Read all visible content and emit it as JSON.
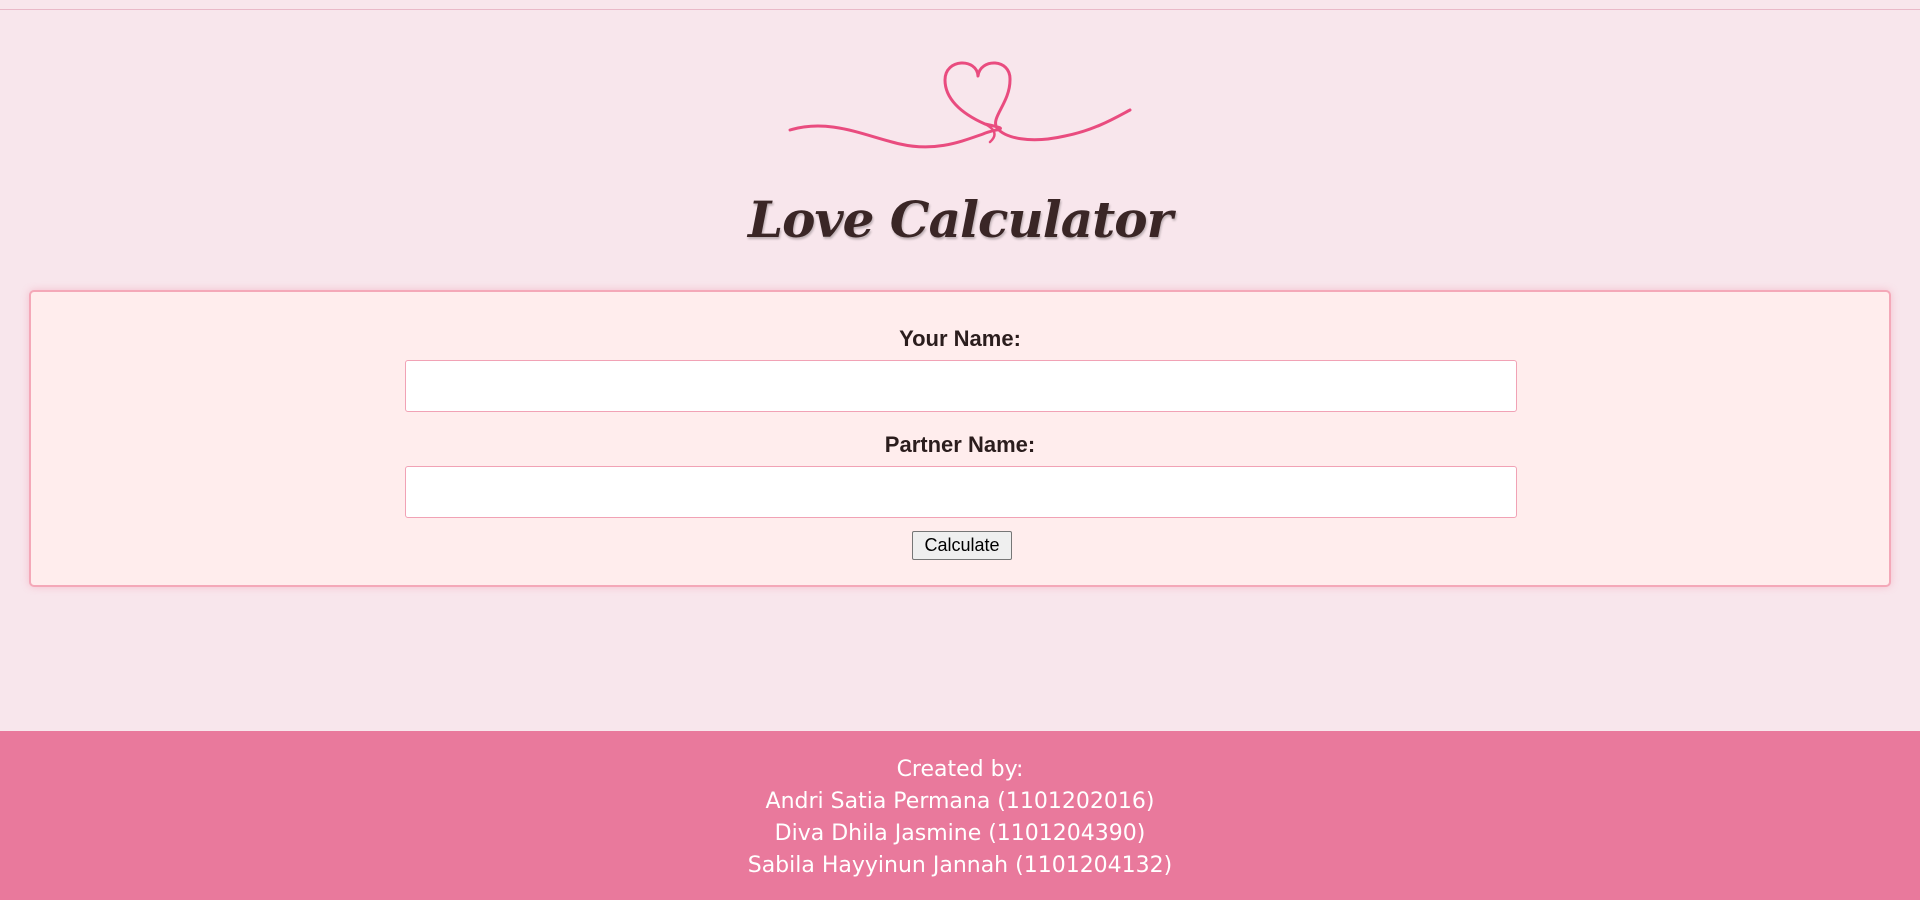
{
  "header": {
    "logo_icon": "heart-ribbon-icon",
    "title": "Love Calculator"
  },
  "form": {
    "your_name_label": "Your Name:",
    "your_name_value": "",
    "partner_name_label": "Partner Name:",
    "partner_name_value": "",
    "calculate_label": "Calculate"
  },
  "footer": {
    "created_by": "Created by:",
    "authors": [
      "Andri Satia Permana (1101202016)",
      "Diva Dhila Jasmine (1101204390)",
      "Sabila Hayyinun Jannah (1101204132)"
    ]
  },
  "colors": {
    "background": "#f8e6ec",
    "card_background": "#ffeded",
    "card_border": "#f4a8b8",
    "accent": "#e94c7f",
    "footer_background": "#e9799c",
    "title_text": "#3a2626"
  }
}
